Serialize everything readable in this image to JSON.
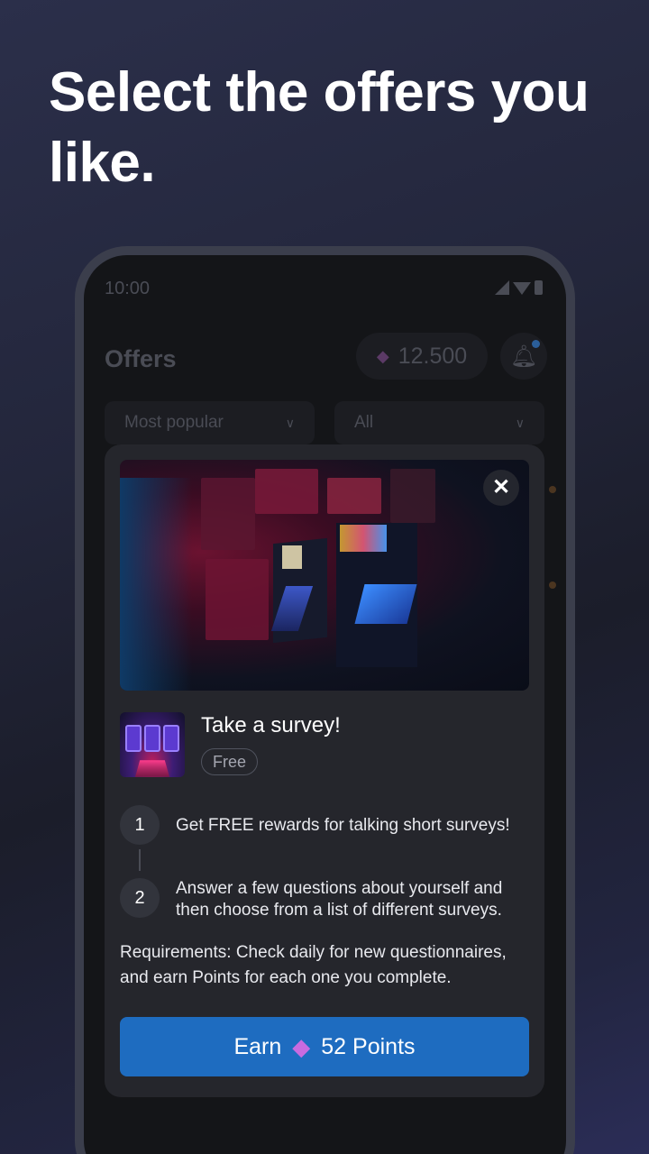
{
  "headline": "Select the offers you like.",
  "status_bar": {
    "time": "10:00"
  },
  "app": {
    "title": "Offers",
    "points_balance": "12.500",
    "filters": {
      "sort": "Most popular",
      "category": "All"
    }
  },
  "modal": {
    "offer_title": "Take a survey!",
    "price_tag": "Free",
    "steps": [
      {
        "number": "1",
        "text": "Get FREE rewards for talking short surveys!"
      },
      {
        "number": "2",
        "text": "Answer a few questions about yourself and then choose from a list of different surveys."
      }
    ],
    "requirements": "Requirements: Check daily for new questionnaires, and earn Points for each one you complete.",
    "earn_button": {
      "prefix": "Earn",
      "amount": "52 Points"
    }
  },
  "colors": {
    "accent_blue": "#1e6cc0",
    "gem_purple": "#c86be0",
    "card_bg": "#25262c"
  },
  "icons": [
    "gem-icon",
    "bell-icon",
    "chevron-down-icon",
    "close-icon",
    "signal-icon",
    "wifi-icon",
    "battery-icon"
  ]
}
